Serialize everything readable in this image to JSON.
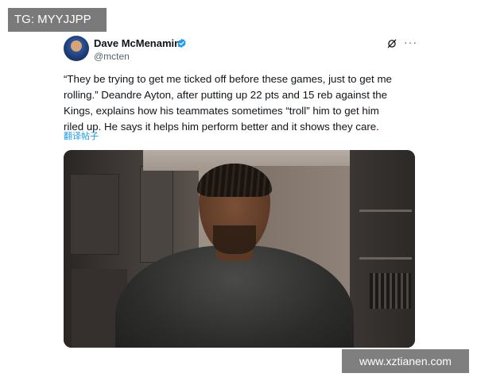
{
  "watermarks": {
    "top_left": "TG: MYYJJPP",
    "bottom_right": "www.xztianen.com"
  },
  "tweet": {
    "author_name": "Dave McMenamin",
    "author_handle": "@mcten",
    "verified": true,
    "lines": [
      "“They be trying to get me ticked off before these games, just to get me",
      "rolling.” Deandre Ayton, after putting up 22 pts and 15 reb against the",
      "Kings, explains how his teammates sometimes “troll” him to get him",
      "riled up. He says it helps him perform better and it shows they care."
    ],
    "translate_label": "翻译帖子",
    "media_kind": "photo",
    "icons": {
      "verified": "verified-badge-icon",
      "grok": "grok-icon",
      "more": "more-options-icon"
    }
  },
  "colors": {
    "link": "#1d9bf0",
    "verified": "#1d9bf0",
    "text": "#0f1419",
    "secondary": "#536471"
  }
}
